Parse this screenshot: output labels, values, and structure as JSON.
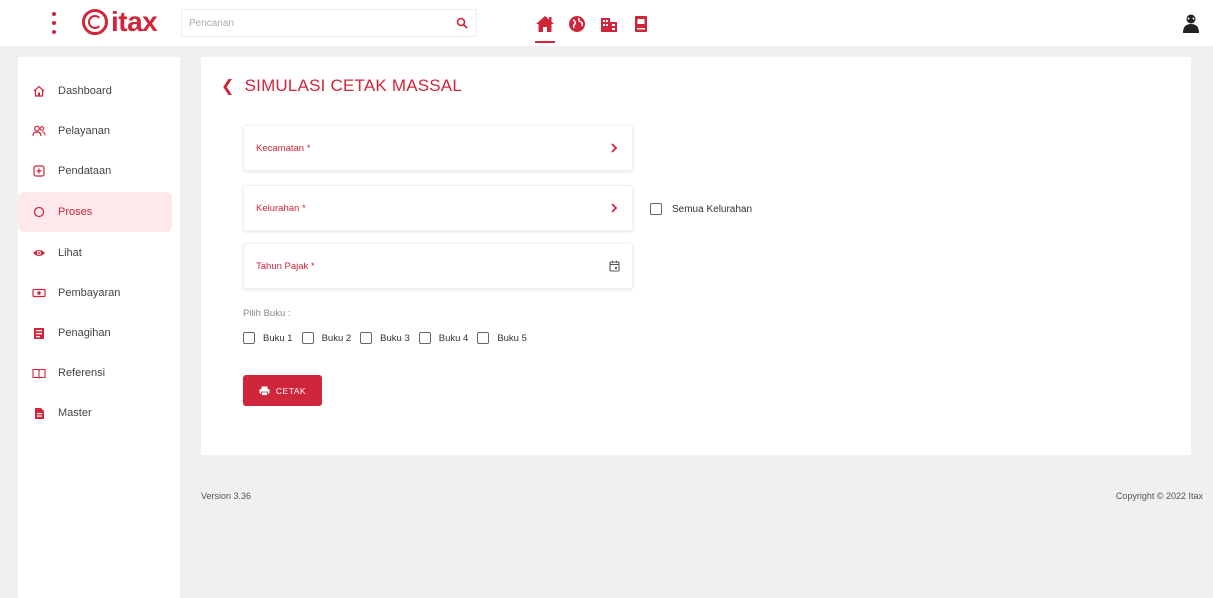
{
  "header": {
    "logo_text": "itax",
    "search_placeholder": "Pencarian",
    "nav_icons": [
      "home-icon",
      "globe-icon",
      "building-icon",
      "book-icon"
    ],
    "active_nav": "home-icon"
  },
  "sidebar": {
    "items": [
      {
        "label": "Dashboard",
        "icon": "home-outline-icon"
      },
      {
        "label": "Pelayanan",
        "icon": "users-icon"
      },
      {
        "label": "Pendataan",
        "icon": "plus-square-icon"
      },
      {
        "label": "Proses",
        "icon": "circle-icon",
        "active": true
      },
      {
        "label": "Lihat",
        "icon": "eye-icon"
      },
      {
        "label": "Pembayaran",
        "icon": "money-icon"
      },
      {
        "label": "Penagihan",
        "icon": "bill-icon"
      },
      {
        "label": "Referensi",
        "icon": "book-open-icon"
      },
      {
        "label": "Master",
        "icon": "file-icon"
      }
    ]
  },
  "main": {
    "title": "SIMULASI CETAK MASSAL",
    "kecamatan_label": "Kecamatan *",
    "kelurahan_label": "Kelurahan *",
    "tahun_label": "Tahun Pajak *",
    "semua_kelurahan": "Semua Kelurahan",
    "pilih_buku": "Pilih Buku :",
    "bukus": [
      "Buku 1",
      "Buku 2",
      "Buku 3",
      "Buku 4",
      "Buku 5"
    ],
    "cetak_label": "CETAK"
  },
  "footer": {
    "version": "Version 3.36",
    "copyright": "Copyright © 2022 Itax"
  },
  "colors": {
    "accent": "#d0263b",
    "active_bg": "#fde9eb",
    "page_bg": "#f0f0f0"
  }
}
